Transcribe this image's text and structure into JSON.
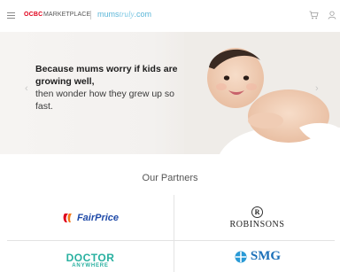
{
  "header": {
    "brand_ocbc": "OCBC",
    "brand_marketplace": "MARKETPLACE",
    "site_mums": "mums",
    "site_truly": "truly",
    "site_domain": ".com",
    "icons": [
      "menu-icon",
      "cart-icon",
      "user-icon"
    ]
  },
  "hero": {
    "title": "Because mums worry if kids are growing well,",
    "subtitle": "then wonder how they grew up so fast.",
    "prev_arrow": "‹",
    "next_arrow": "›"
  },
  "partners": {
    "title": "Our Partners",
    "items": [
      {
        "name": "FairPrice"
      },
      {
        "name": "ROBINSONS",
        "badge": "R"
      },
      {
        "name": "DOCTOR",
        "sub": "ANYWHERE"
      },
      {
        "name": "SMG"
      }
    ]
  },
  "colors": {
    "ocbc_red": "#e0001b",
    "mums_blue": "#5bb6d8",
    "fairprice_blue": "#1f4aa8",
    "doctor_teal": "#28b0a0",
    "smg_blue": "#1b6fb8"
  }
}
